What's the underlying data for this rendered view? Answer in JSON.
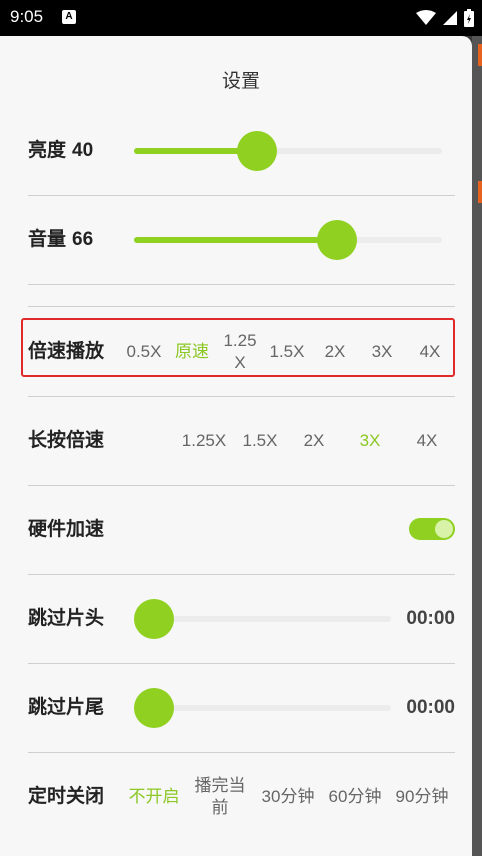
{
  "status_bar": {
    "time": "9:05",
    "notification_icon": "A"
  },
  "title": "设置",
  "brightness": {
    "label": "亮度",
    "value": "40",
    "fraction": 0.4
  },
  "volume": {
    "label": "音量",
    "value": "66",
    "fraction": 0.66
  },
  "playback_speed": {
    "label": "倍速播放",
    "options": [
      "0.5X",
      "原速",
      "1.25\nX",
      "1.5X",
      "2X",
      "3X",
      "4X"
    ],
    "selected_index": 1
  },
  "long_press_speed": {
    "label": "长按倍速",
    "options": [
      "1.25X",
      "1.5X",
      "2X",
      "3X",
      "4X"
    ],
    "selected_index": 3
  },
  "hardware_accel": {
    "label": "硬件加速",
    "enabled": true
  },
  "skip_intro": {
    "label": "跳过片头",
    "time": "00:00",
    "fraction": 0
  },
  "skip_outro": {
    "label": "跳过片尾",
    "time": "00:00",
    "fraction": 0
  },
  "sleep_timer": {
    "label": "定时关闭",
    "options": [
      "不开启",
      "播完当\n前",
      "30分钟",
      "60分钟",
      "90分钟"
    ],
    "selected_index": 0
  },
  "colors": {
    "accent": "#8fd021",
    "highlight_box": "#e02a2a"
  }
}
